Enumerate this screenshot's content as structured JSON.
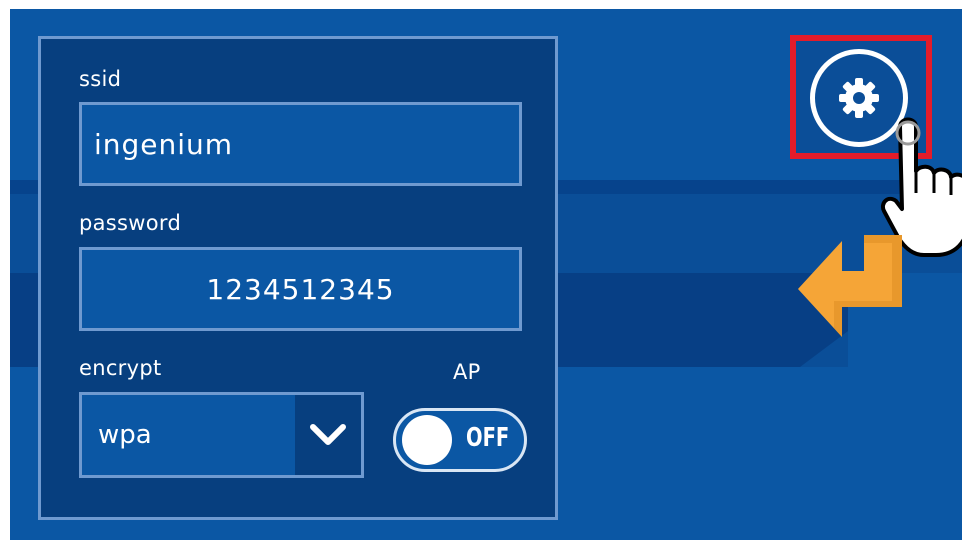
{
  "form": {
    "ssid_label": "ssid",
    "ssid_value": "ingenium",
    "password_label": "password",
    "password_value": "1234512345",
    "encrypt_label": "encrypt",
    "encrypt_value": "wpa",
    "ap_label": "AP",
    "ap_state": "OFF"
  },
  "icons": {
    "settings": "gear-icon",
    "pointer": "pointing-hand-icon",
    "back": "back-arrow-icon",
    "dropdown": "chevron-down-icon"
  },
  "colors": {
    "background": "#0b57a4",
    "panel": "#073f7f",
    "border": "#6f9ad0",
    "highlight": "#e41c2a",
    "arrow": "#f5a537"
  }
}
